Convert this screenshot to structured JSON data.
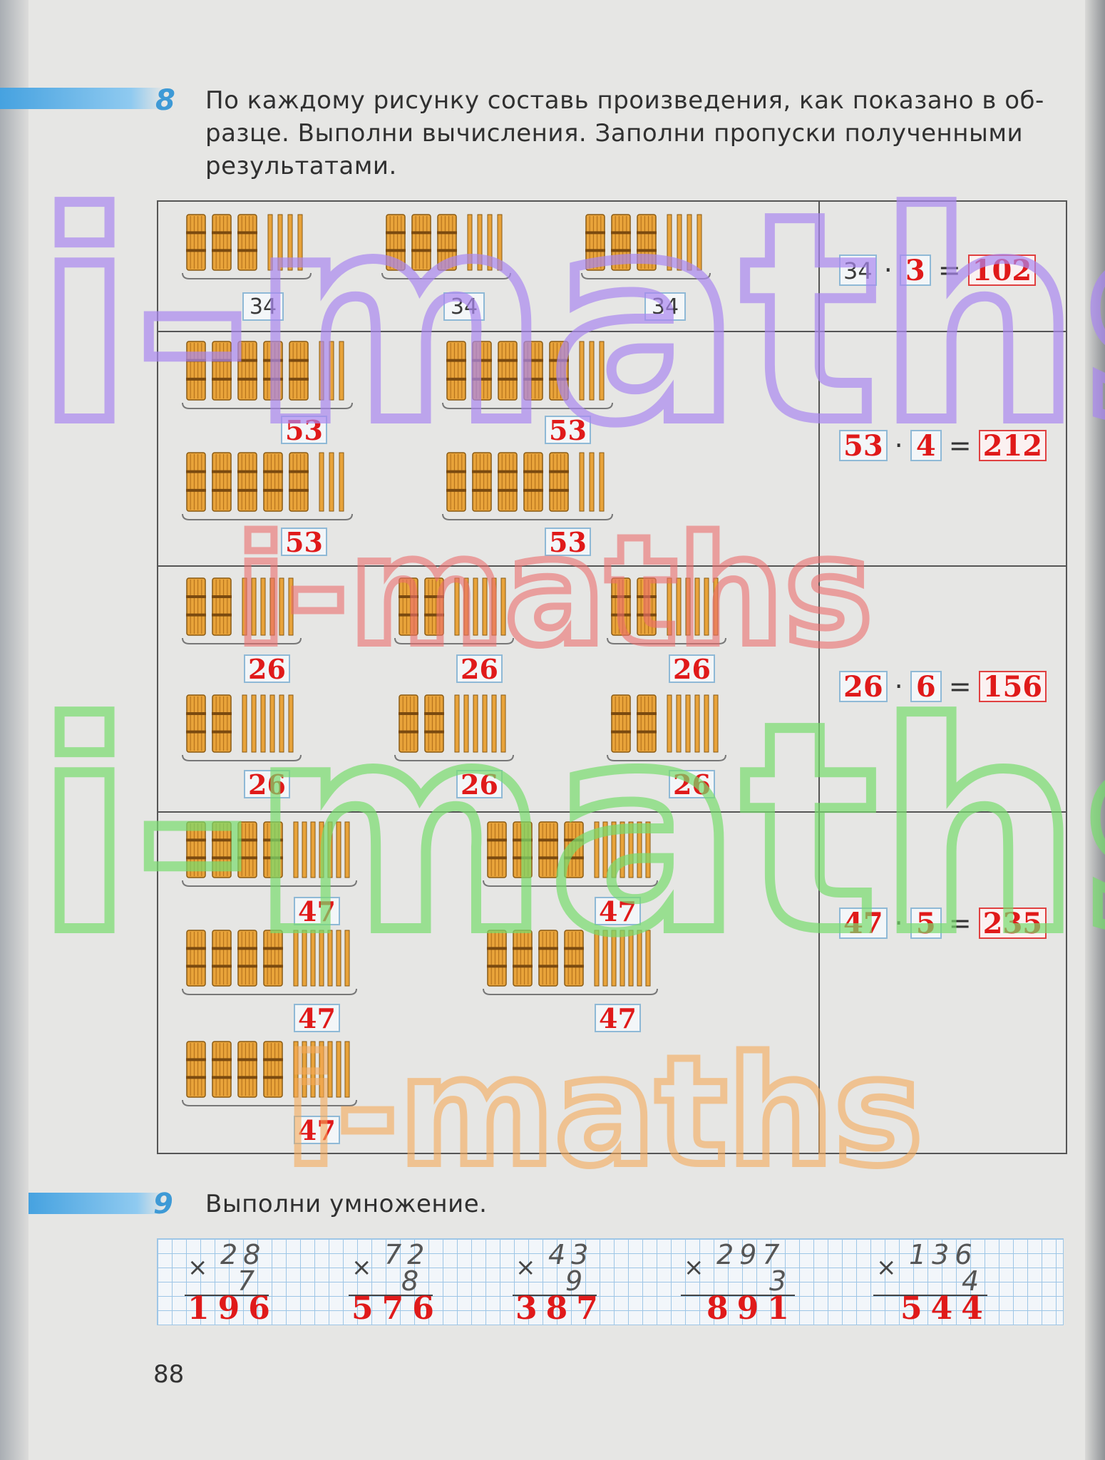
{
  "task8": {
    "number": "8",
    "text_line1": "По каждому рисунку составь произведения, как показано в об-",
    "text_line2": "разце. Выполни вычисления. Заполни пропуски полученными",
    "text_line3": "результатами."
  },
  "rows": [
    {
      "labels": [
        "34",
        "34",
        "34"
      ],
      "eq": {
        "a": "34",
        "b": "3",
        "result": "102"
      }
    },
    {
      "labels": [
        "53",
        "53",
        "53",
        "53"
      ],
      "eq": {
        "a": "53",
        "b": "4",
        "result": "212"
      }
    },
    {
      "labels": [
        "26",
        "26",
        "26",
        "26",
        "26",
        "26"
      ],
      "eq": {
        "a": "26",
        "b": "6",
        "result": "156"
      }
    },
    {
      "labels": [
        "47",
        "47",
        "47",
        "47",
        "47"
      ],
      "eq": {
        "a": "47",
        "b": "5",
        "result": "235"
      }
    }
  ],
  "task9": {
    "number": "9",
    "text": "Выполни умножение.",
    "problems": [
      {
        "top": "28",
        "bottom": "7",
        "result": "196"
      },
      {
        "top": "72",
        "bottom": "8",
        "result": "576"
      },
      {
        "top": "43",
        "bottom": "9",
        "result": "387"
      },
      {
        "top": "297",
        "bottom": "3",
        "result": "891"
      },
      {
        "top": "136",
        "bottom": "4",
        "result": "544"
      }
    ]
  },
  "page_number": "88",
  "watermark": "i-maths",
  "colors": {
    "answer": "#e01a1a",
    "accent_blue": "#3e9ad6",
    "bundle": "#e8a33a"
  }
}
